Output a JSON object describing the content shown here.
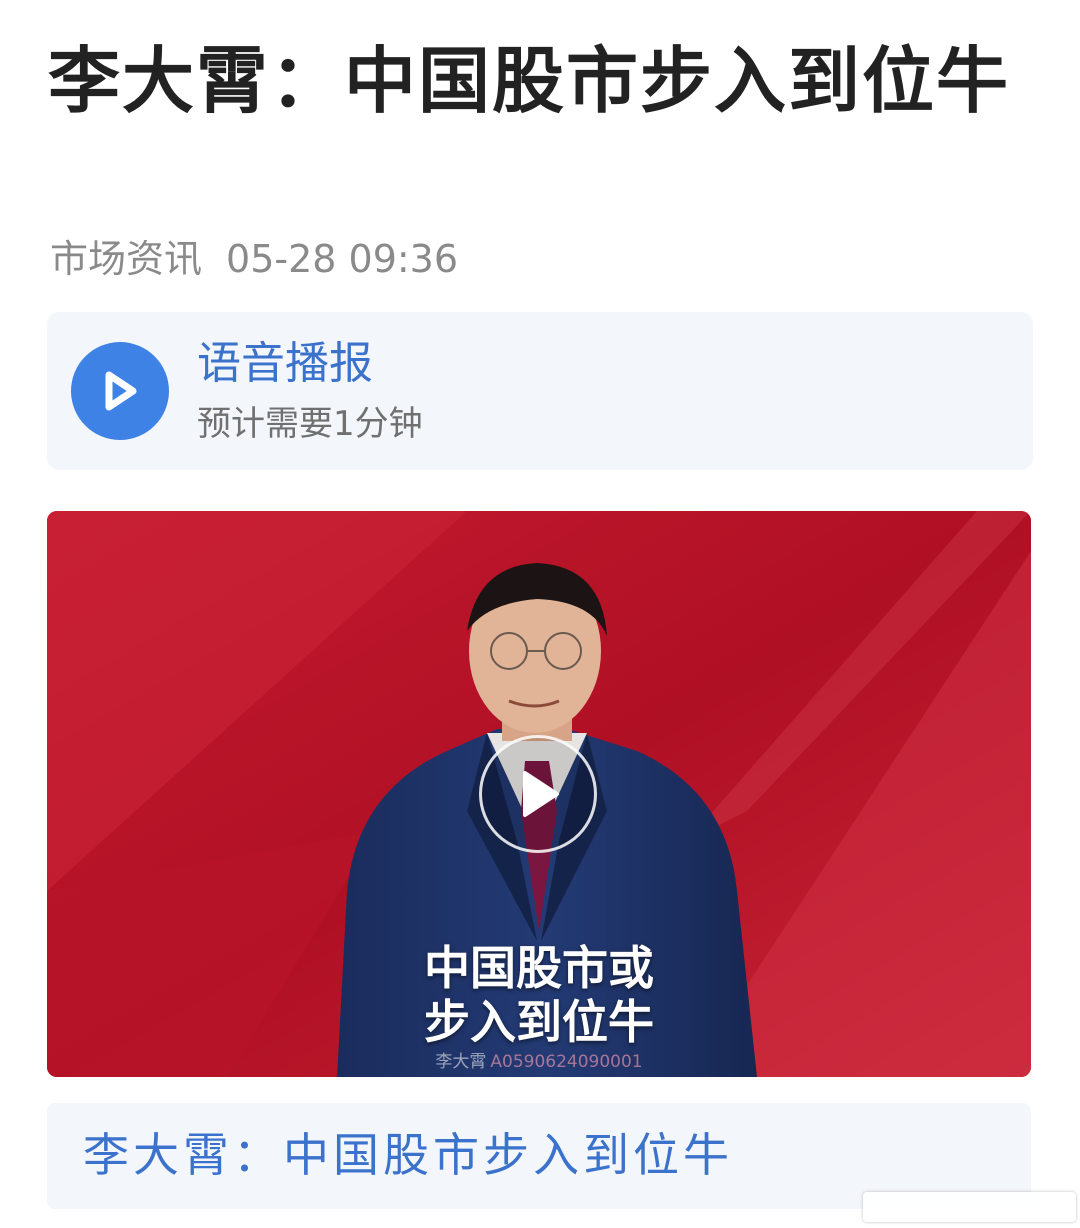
{
  "article": {
    "title": "李大霄：中国股市步入到位牛",
    "source": "市场资讯",
    "datetime": "05-28 09:36"
  },
  "audio_card": {
    "title": "语音播报",
    "subtitle": "预计需要1分钟",
    "play_icon": "play-icon",
    "accent_color": "#3f82e6"
  },
  "video": {
    "caption_line1": "中国股市或",
    "caption_line2": "步入到位牛",
    "watermark_name": "李大霄",
    "watermark_code": "A0590624090001",
    "play_icon": "play-icon",
    "background_color": "#b8142a"
  },
  "link_card": {
    "text": "李大霄：中国股市步入到位牛",
    "color": "#3b72cc"
  }
}
